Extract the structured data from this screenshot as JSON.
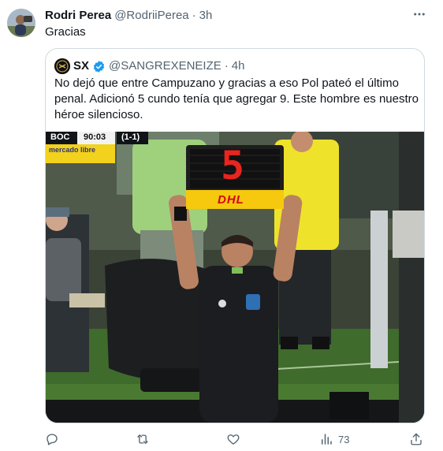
{
  "tweet": {
    "display_name": "Rodri Perea",
    "handle": "@RodriiPerea",
    "separator": "·",
    "time": "3h",
    "text": "Gracias"
  },
  "quoted": {
    "display_name": "SX",
    "handle": "@SANGREXENEIZE",
    "separator": "·",
    "time": "4h",
    "text": "No dejó que entre Campuzano y gracias a eso Pol pateó el último penal. Adicionó 5 cundo tenía que agregar 9. Este hombre es nuestro héroe silencioso.",
    "verified": true,
    "media": {
      "scoreboard_team": "BOC",
      "scoreboard_time": "90:03",
      "scoreboard_score": "(1-1)",
      "sponsor": "mercado libre",
      "board_number": "5",
      "board_brand": "DHL"
    }
  },
  "actions": {
    "views_count": "73"
  },
  "colors": {
    "text": "#0f1419",
    "muted": "#536471",
    "border": "#cfd9de",
    "verified": "#1d9bf0",
    "pitch": "#3f6b2c",
    "board_red": "#e8251e",
    "dhl_yellow": "#f6c80e",
    "vest_yellow": "#efe22a"
  }
}
